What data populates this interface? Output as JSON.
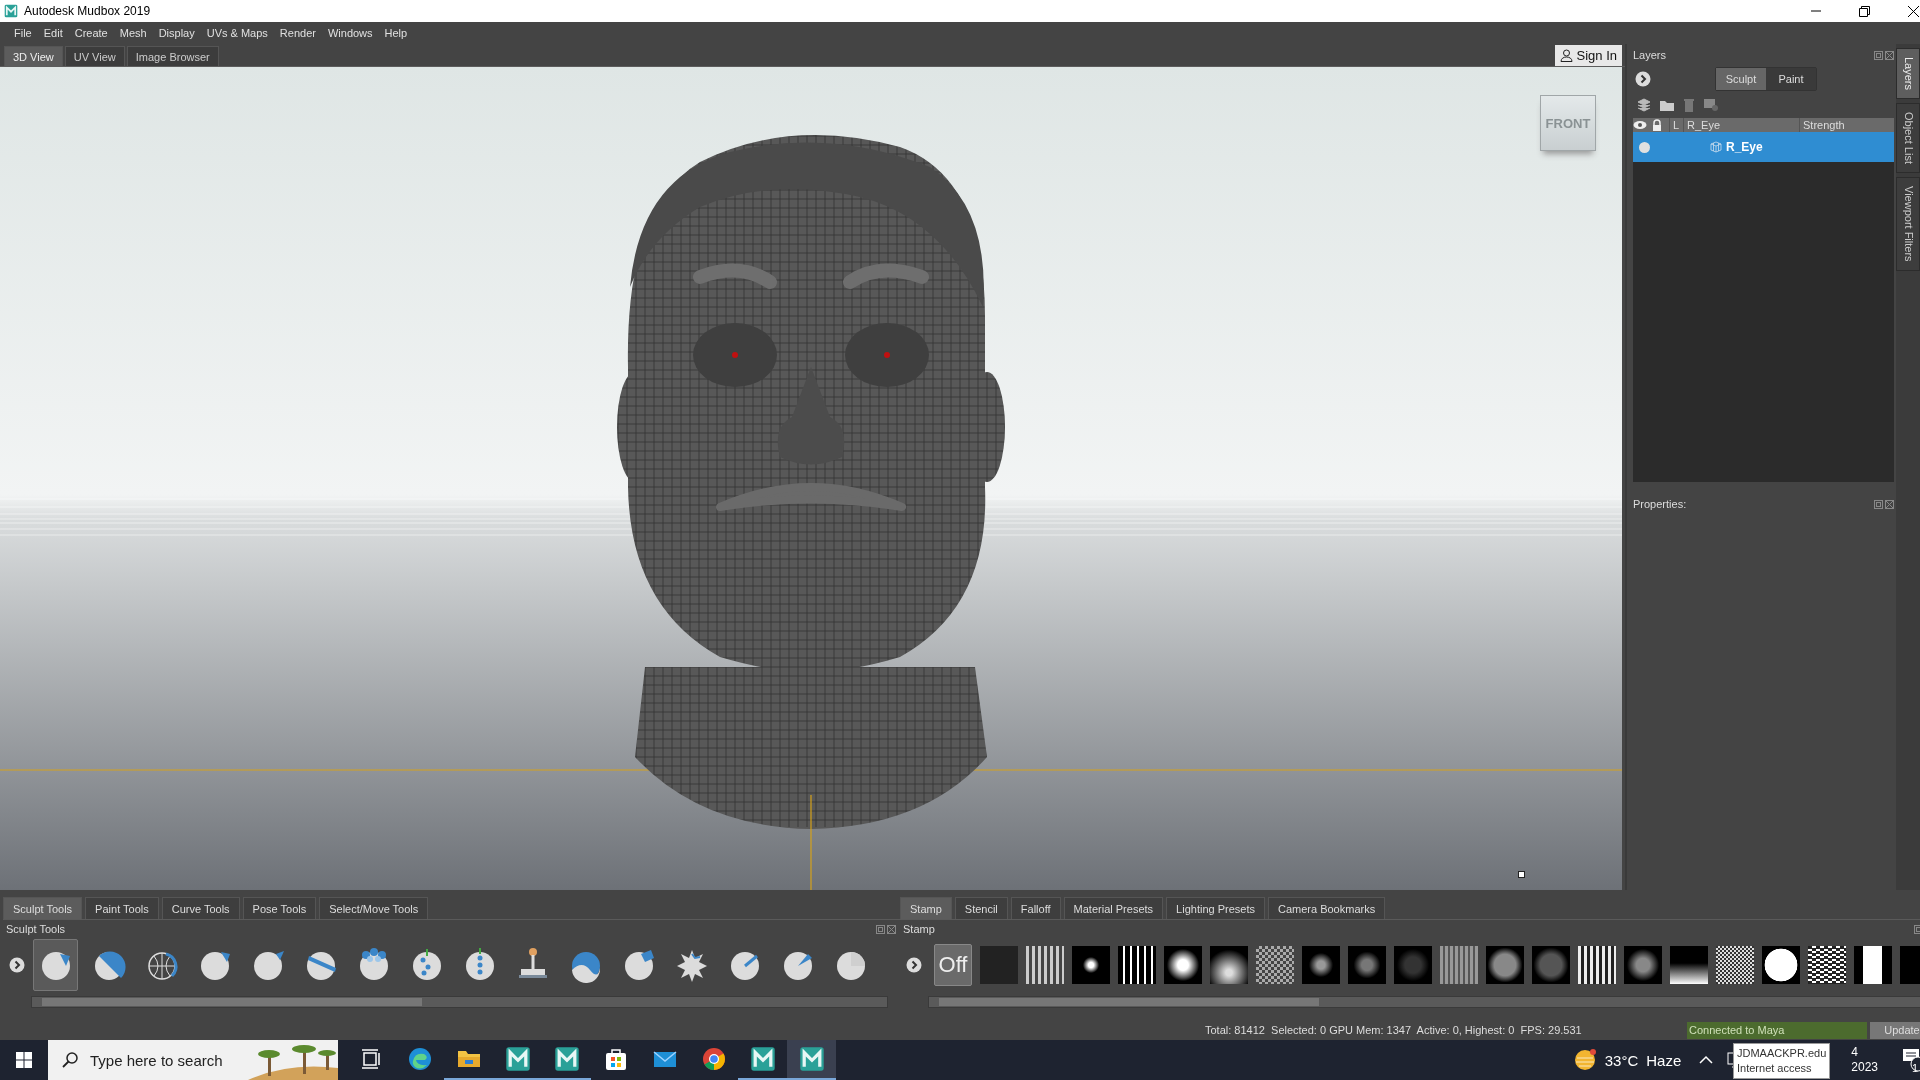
{
  "window": {
    "title": "Autodesk Mudbox 2019"
  },
  "menu": [
    "File",
    "Edit",
    "Create",
    "Mesh",
    "Display",
    "UVs & Maps",
    "Render",
    "Windows",
    "Help"
  ],
  "view_tabs": [
    {
      "label": "3D View",
      "selected": true
    },
    {
      "label": "UV View",
      "selected": false
    },
    {
      "label": "Image Browser",
      "selected": false
    }
  ],
  "sign_in": "Sign In",
  "viewport": {
    "view_cube": "FRONT"
  },
  "layers_panel": {
    "title": "Layers",
    "modes": [
      {
        "label": "Sculpt",
        "selected": true
      },
      {
        "label": "Paint",
        "selected": false
      }
    ],
    "columns": [
      "L",
      "R_Eye",
      "Strength"
    ],
    "rows": [
      {
        "name": "R_Eye",
        "visible": true,
        "selected": true
      }
    ]
  },
  "properties_panel": {
    "title": "Properties:"
  },
  "side_tabs": [
    {
      "label": "Layers",
      "selected": true
    },
    {
      "label": "Object List",
      "selected": false
    },
    {
      "label": "Viewport Filters",
      "selected": false
    }
  ],
  "tool_tabs": [
    {
      "label": "Sculpt Tools",
      "selected": true
    },
    {
      "label": "Paint Tools",
      "selected": false
    },
    {
      "label": "Curve Tools",
      "selected": false
    },
    {
      "label": "Pose Tools",
      "selected": false
    },
    {
      "label": "Select/Move Tools",
      "selected": false
    }
  ],
  "tools_panel": {
    "title": "Sculpt Tools",
    "tools": [
      {
        "kind": "sculpt",
        "selected": true
      },
      {
        "kind": "smooth",
        "selected": false
      },
      {
        "kind": "relax",
        "selected": false
      },
      {
        "kind": "grab",
        "selected": false
      },
      {
        "kind": "pinch",
        "selected": false
      },
      {
        "kind": "flatten",
        "selected": false
      },
      {
        "kind": "foamy",
        "selected": false
      },
      {
        "kind": "spray",
        "selected": false
      },
      {
        "kind": "repeat",
        "selected": false
      },
      {
        "kind": "imprint",
        "selected": false
      },
      {
        "kind": "wax",
        "selected": false
      },
      {
        "kind": "scrape",
        "selected": false
      },
      {
        "kind": "fill",
        "selected": false
      },
      {
        "kind": "knife",
        "selected": false
      },
      {
        "kind": "smear",
        "selected": false
      },
      {
        "kind": "partial",
        "selected": false
      }
    ]
  },
  "stamp_tabs": [
    {
      "label": "Stamp",
      "selected": true
    },
    {
      "label": "Stencil",
      "selected": false
    },
    {
      "label": "Falloff",
      "selected": false
    },
    {
      "label": "Material Presets",
      "selected": false
    },
    {
      "label": "Lighting Presets",
      "selected": false
    },
    {
      "label": "Camera Bookmarks",
      "selected": false
    }
  ],
  "stamp_panel": {
    "title": "Stamp",
    "off_button": "Off"
  },
  "status_bar": {
    "stats": "Total: 81412  Selected: 0 GPU Mem: 1347  Active: 0, Highest: 0  FPS: 29.531",
    "connection": "Connected to Maya",
    "update_button": "Update"
  },
  "taskbar": {
    "search_placeholder": "Type here to search",
    "apps": [
      {
        "kind": "taskview",
        "running": false,
        "selected": false
      },
      {
        "kind": "browser",
        "running": false,
        "selected": false
      },
      {
        "kind": "folder",
        "running": true,
        "selected": false
      },
      {
        "kind": "teal",
        "running": true,
        "selected": false
      },
      {
        "kind": "teal",
        "running": true,
        "selected": false
      },
      {
        "kind": "store",
        "running": false,
        "selected": false
      },
      {
        "kind": "mail",
        "running": false,
        "selected": false
      },
      {
        "kind": "chrome",
        "running": false,
        "selected": false
      },
      {
        "kind": "teal",
        "running": true,
        "selected": false
      },
      {
        "kind": "teal",
        "running": true,
        "selected": true
      }
    ],
    "temperature": "33°C",
    "weather": "Haze",
    "tooltip": [
      "JDMAACKPR.edu",
      "Internet access"
    ],
    "clock": [
      "4",
      "2023"
    ],
    "notification_count": "1"
  }
}
